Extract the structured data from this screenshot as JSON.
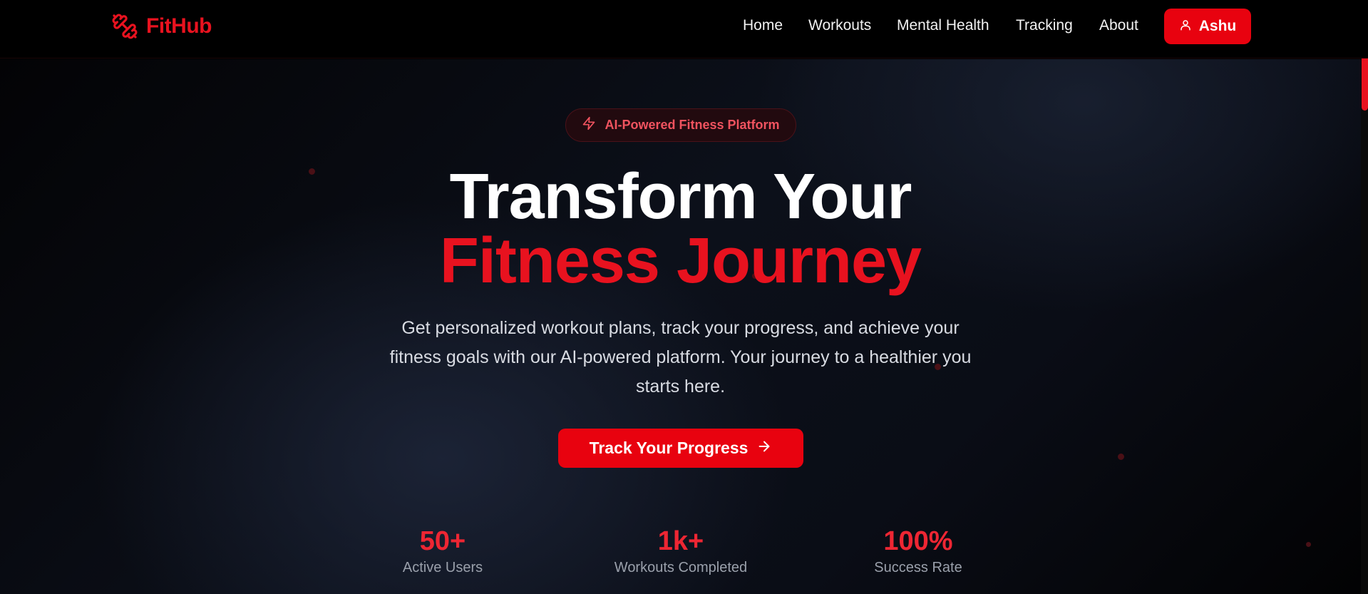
{
  "brand": {
    "name": "FitHub",
    "icon": "dumbbell-icon",
    "color": "#e8121f"
  },
  "nav": {
    "items": [
      {
        "label": "Home"
      },
      {
        "label": "Workouts"
      },
      {
        "label": "Mental Health"
      },
      {
        "label": "Tracking"
      },
      {
        "label": "About"
      }
    ],
    "user": {
      "label": "Ashu",
      "icon": "user-icon"
    }
  },
  "hero": {
    "badge": {
      "label": "AI-Powered Fitness Platform",
      "icon": "lightning-icon"
    },
    "title_line1": "Transform Your",
    "title_line2": "Fitness Journey",
    "description": "Get personalized workout plans, track your progress, and achieve your fitness goals with our AI-powered platform. Your journey to a healthier you starts here.",
    "cta": {
      "label": "Track Your Progress",
      "icon": "arrow-right-icon"
    }
  },
  "stats": [
    {
      "value": "50+",
      "label": "Active Users"
    },
    {
      "value": "1k+",
      "label": "Workouts Completed"
    },
    {
      "value": "100%",
      "label": "Success Rate"
    }
  ],
  "colors": {
    "accent": "#e8020f",
    "accent_text": "#e8121f",
    "background": "#000000"
  }
}
